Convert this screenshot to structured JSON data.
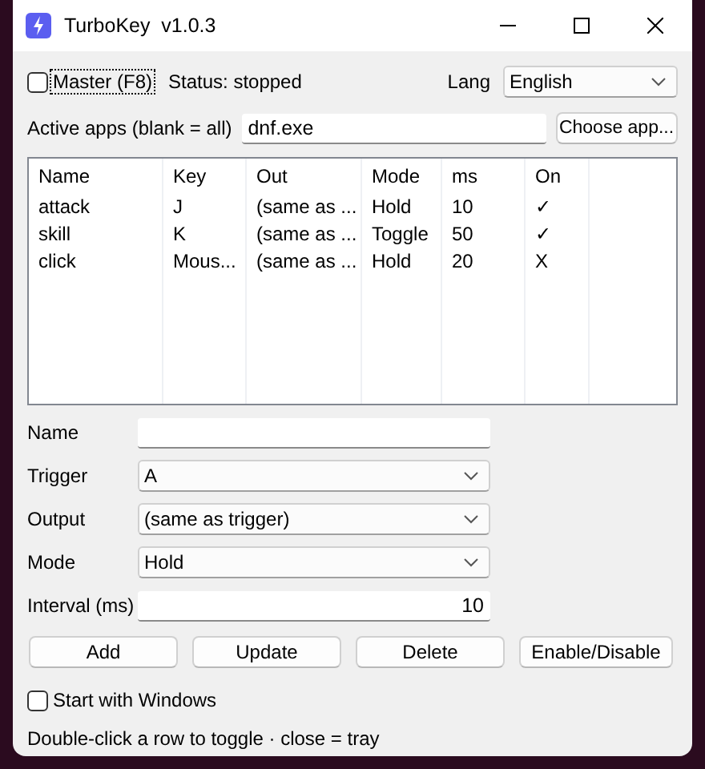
{
  "window": {
    "title": "TurboKey  v1.0.3"
  },
  "master": {
    "label": "Master (F8)",
    "checked": false
  },
  "status": "Status: stopped",
  "lang": {
    "label": "Lang",
    "value": "English"
  },
  "active_apps": {
    "label": "Active apps (blank = all)",
    "value": "dnf.exe",
    "button": "Choose app..."
  },
  "table": {
    "columns": [
      "Name",
      "Key",
      "Out",
      "Mode",
      "ms",
      "On"
    ],
    "rows": [
      {
        "cells": [
          "attack",
          "J",
          "(same as ...",
          "Hold",
          "10",
          "✓"
        ]
      },
      {
        "cells": [
          "skill",
          "K",
          "(same as ...",
          "Toggle",
          "50",
          "✓"
        ]
      },
      {
        "cells": [
          "click",
          "Mous...",
          "(same as ...",
          "Hold",
          "20",
          "X"
        ]
      }
    ]
  },
  "form": [
    {
      "kind": "text",
      "label": "Name"
    },
    {
      "kind": "select",
      "label": "Trigger",
      "value": "A"
    },
    {
      "kind": "select",
      "label": "Output",
      "value": "(same as trigger)"
    },
    {
      "kind": "select",
      "label": "Mode",
      "value": "Hold"
    },
    {
      "kind": "number",
      "label": "Interval (ms)",
      "value": "10"
    }
  ],
  "buttons": [
    "Add",
    "Update",
    "Delete",
    "Enable/Disable"
  ],
  "start_with_windows": {
    "label": "Start with Windows",
    "checked": false
  },
  "footer": "Double-click a row to toggle · close = tray"
}
